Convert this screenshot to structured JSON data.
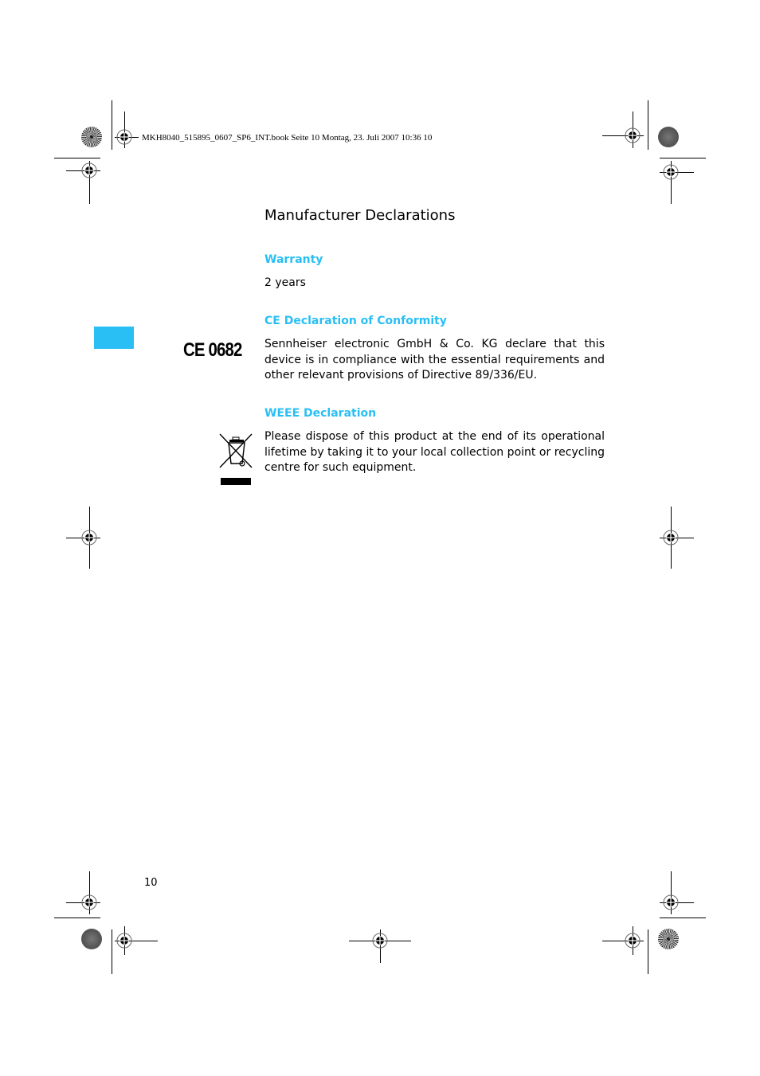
{
  "print_slug": "MKH8040_515895_0607_SP6_INT.book  Seite 10  Montag, 23. Juli 2007  10:36 10",
  "page": {
    "title": "Manufacturer Declarations",
    "page_number": "10",
    "accent_color": "#29bff5"
  },
  "sections": [
    {
      "heading": "Warranty",
      "body": "2 years"
    },
    {
      "heading": "CE Declaration of Conformity",
      "icon": "ce-mark-icon",
      "icon_text": "CE 0682",
      "body": "Sennheiser electronic GmbH & Co. KG declare that this device is in compliance with the essential requirements and other relevant provisions of Directive 89/336/EU."
    },
    {
      "heading": "WEEE Declaration",
      "icon": "crossed-out-wheelie-bin-icon",
      "body": "Please dispose of this product at the end of its operational lifetime by taking it to your local collection point or recycling centre for such equipment."
    }
  ]
}
